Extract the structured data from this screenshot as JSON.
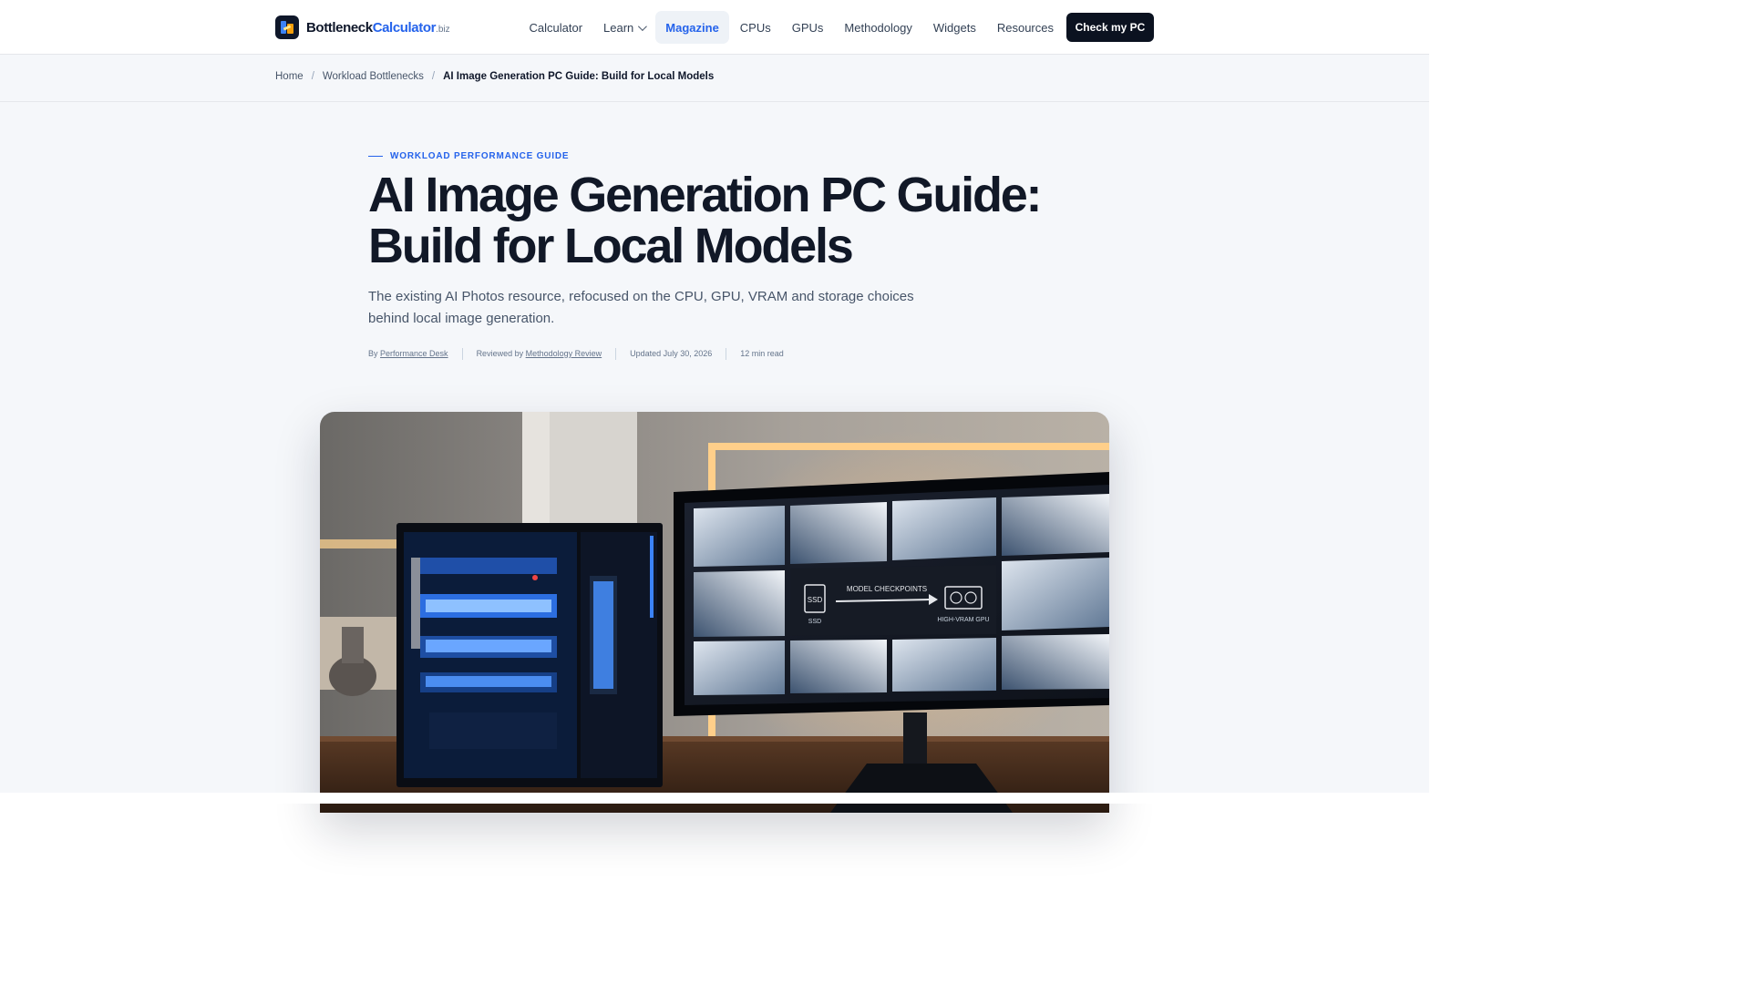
{
  "header": {
    "logo": {
      "name": "Bottleneck",
      "accent": "Calculator",
      "tld": ".biz"
    },
    "nav": [
      {
        "label": "Calculator",
        "name": "nav-calculator"
      },
      {
        "label": "Learn",
        "name": "nav-learn",
        "dropdown": true
      },
      {
        "label": "Magazine",
        "name": "nav-magazine",
        "active": true
      },
      {
        "label": "CPUs",
        "name": "nav-cpus"
      },
      {
        "label": "GPUs",
        "name": "nav-gpus"
      },
      {
        "label": "Methodology",
        "name": "nav-methodology"
      },
      {
        "label": "Widgets",
        "name": "nav-widgets"
      },
      {
        "label": "Resources",
        "name": "nav-resources"
      }
    ],
    "cta_label": "Check my PC"
  },
  "breadcrumb": {
    "items": [
      "Home",
      "Workload Bottlenecks"
    ],
    "current": "AI Image Generation PC Guide: Build for Local Models"
  },
  "article": {
    "kicker": "WORKLOAD PERFORMANCE GUIDE",
    "title": "AI Image Generation PC Guide: Build for Local Models",
    "subtitle": "The existing AI Photos resource, refocused on the CPU, GPU, VRAM and storage choices behind local image generation.",
    "meta": {
      "by_prefix": "By",
      "author": "Performance Desk",
      "reviewed_prefix": "Reviewed by",
      "reviewer": "Methodology Review",
      "updated": "Updated July 30, 2026",
      "read_time": "12 min read"
    }
  },
  "hero_image": {
    "ssd_label": "SSD",
    "ssd_caption": "SSD",
    "flow_label": "MODEL CHECKPOINTS",
    "gpu_caption": "HIGH-VRAM GPU"
  },
  "colors": {
    "accent": "#2563eb",
    "brand_dark": "#0b1220",
    "hero_bg": "#f5f7fa"
  }
}
